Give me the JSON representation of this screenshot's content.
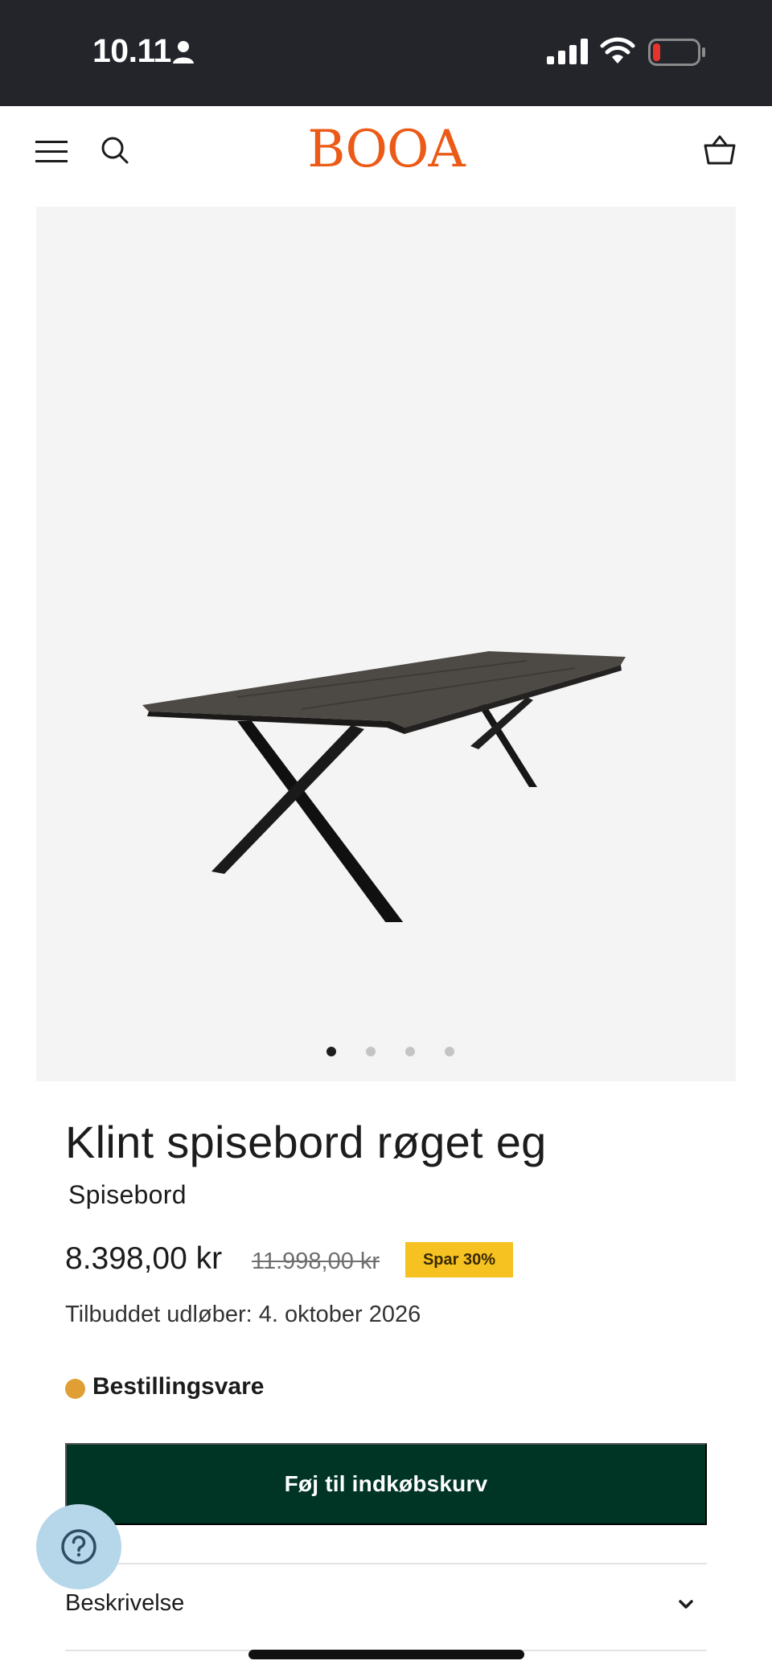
{
  "status_bar": {
    "time": "10.11",
    "battery_color": "#e5342b"
  },
  "header": {
    "logo": "BOOA",
    "logo_color": "#ec5a17",
    "icons": [
      "menu-icon",
      "search-icon",
      "cart-icon"
    ]
  },
  "gallery": {
    "slide_count": 4,
    "active_slide": 1
  },
  "product": {
    "title": "Klint spisebord røget eg",
    "category": "Spisebord",
    "price": "8.398,00 kr",
    "original_price": "11.998,00 kr",
    "discount_badge": "Spar 30%",
    "offer_expiry": "Tilbuddet udløber: 4. oktober 2026",
    "stock_status": "Bestillingsvare",
    "stock_color": "#e09f35"
  },
  "actions": {
    "add_to_cart": "Føj til indkøbskurv",
    "button_color": "#003526"
  },
  "accordion": {
    "description_label": "Beskrivelse"
  },
  "help_widget": {
    "icon": "question-icon"
  }
}
